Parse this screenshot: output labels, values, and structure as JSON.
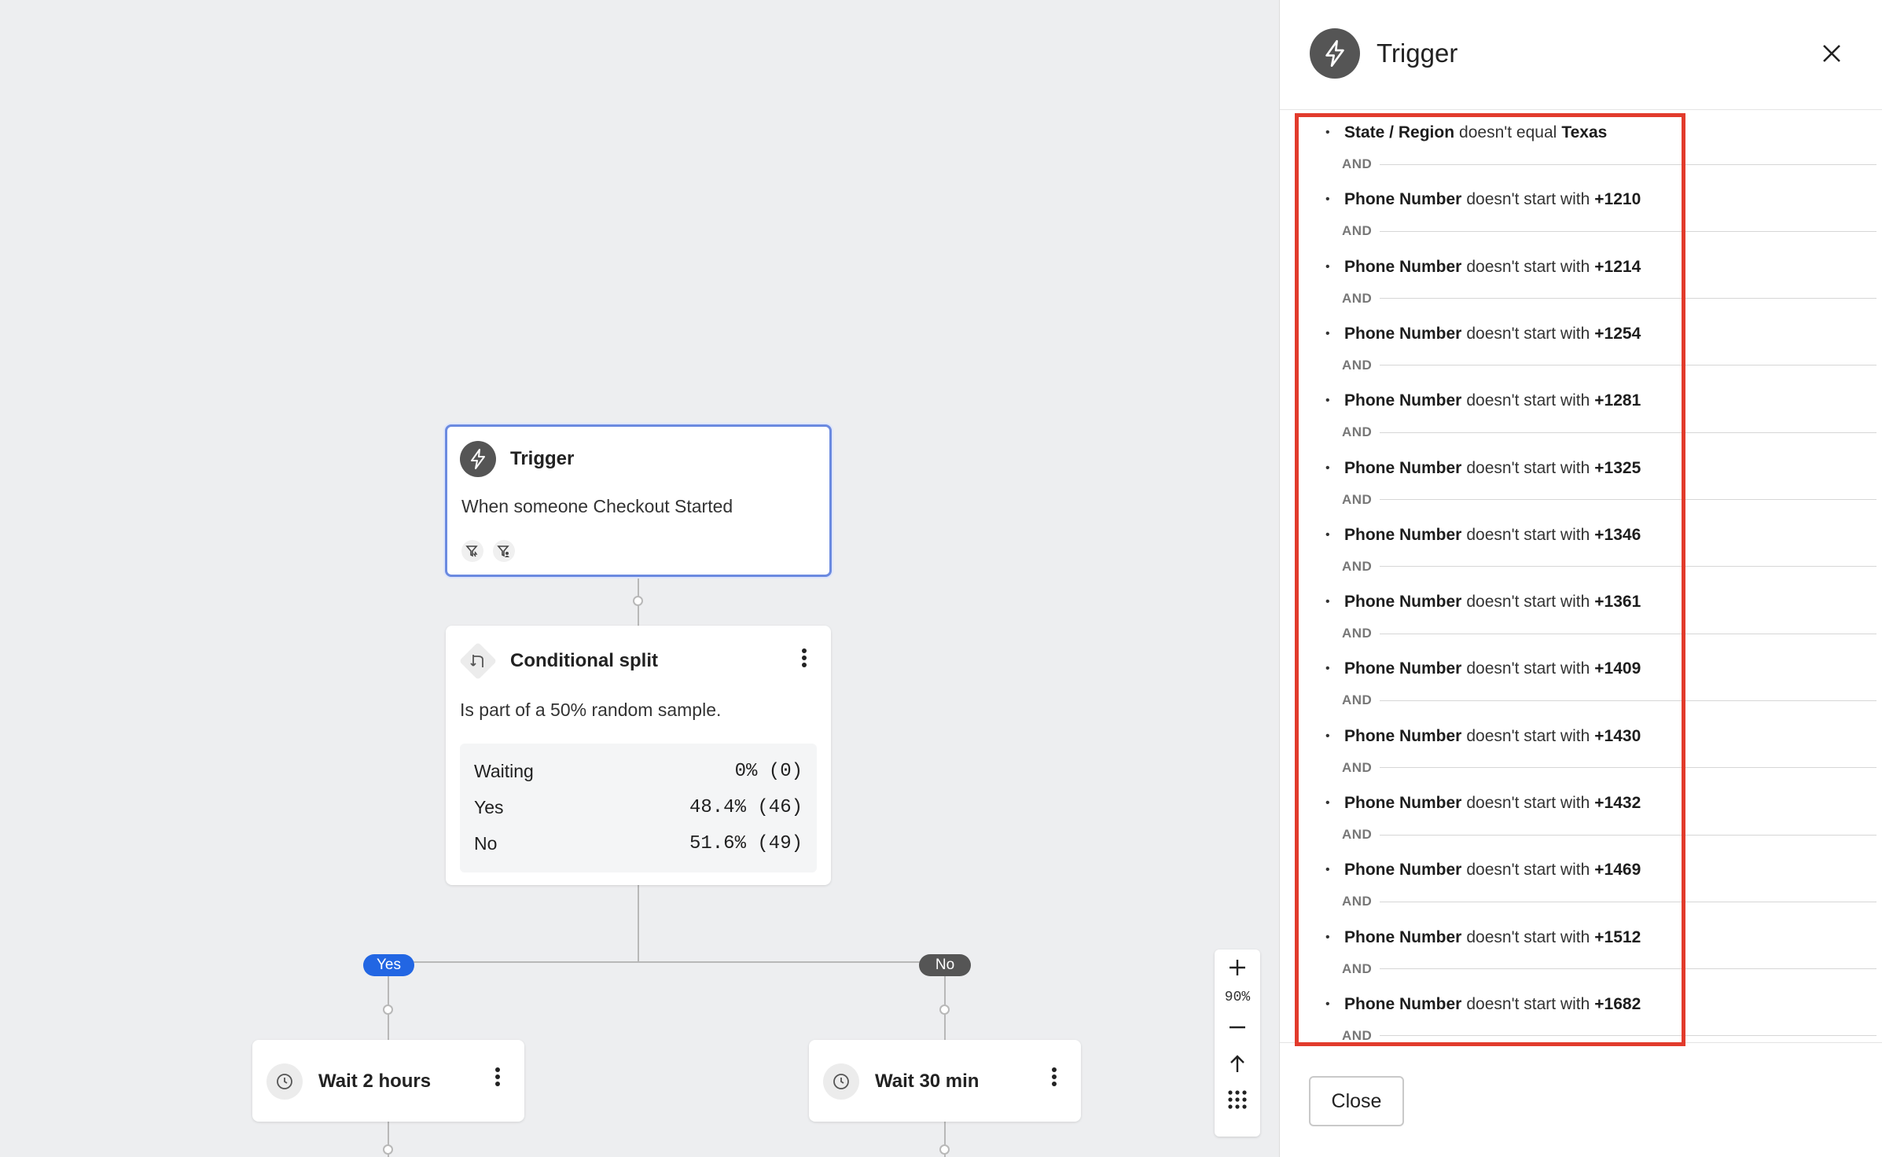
{
  "canvas": {
    "trigger_node": {
      "title": "Trigger",
      "description": "When someone Checkout Started",
      "icon": "lightning-icon",
      "filter_icons": [
        "trigger-filter-icon",
        "profile-filter-icon"
      ]
    },
    "split_node": {
      "title": "Conditional split",
      "description": "Is part of a 50% random sample.",
      "stats": [
        {
          "label": "Waiting",
          "value": "0% (0)"
        },
        {
          "label": "Yes",
          "value": "48.4% (46)"
        },
        {
          "label": "No",
          "value": "51.6% (49)"
        }
      ]
    },
    "branch_labels": {
      "yes": "Yes",
      "no": "No"
    },
    "wait_left": {
      "title": "Wait 2 hours"
    },
    "wait_right": {
      "title": "Wait 30 min"
    },
    "zoom": {
      "level": "90%"
    }
  },
  "panel": {
    "title": "Trigger",
    "conditions": [
      {
        "field": "State / Region",
        "op": "doesn't equal",
        "value": "Texas"
      },
      {
        "field": "Phone Number",
        "op": "doesn't start with",
        "value": "+1210"
      },
      {
        "field": "Phone Number",
        "op": "doesn't start with",
        "value": "+1214"
      },
      {
        "field": "Phone Number",
        "op": "doesn't start with",
        "value": "+1254"
      },
      {
        "field": "Phone Number",
        "op": "doesn't start with",
        "value": "+1281"
      },
      {
        "field": "Phone Number",
        "op": "doesn't start with",
        "value": "+1325"
      },
      {
        "field": "Phone Number",
        "op": "doesn't start with",
        "value": "+1346"
      },
      {
        "field": "Phone Number",
        "op": "doesn't start with",
        "value": "+1361"
      },
      {
        "field": "Phone Number",
        "op": "doesn't start with",
        "value": "+1409"
      },
      {
        "field": "Phone Number",
        "op": "doesn't start with",
        "value": "+1430"
      },
      {
        "field": "Phone Number",
        "op": "doesn't start with",
        "value": "+1432"
      },
      {
        "field": "Phone Number",
        "op": "doesn't start with",
        "value": "+1469"
      },
      {
        "field": "Phone Number",
        "op": "doesn't start with",
        "value": "+1512"
      },
      {
        "field": "Phone Number",
        "op": "doesn't start with",
        "value": "+1682"
      }
    ],
    "and_label": "AND",
    "close_button": "Close",
    "highlight_color": "#e23b2c"
  }
}
